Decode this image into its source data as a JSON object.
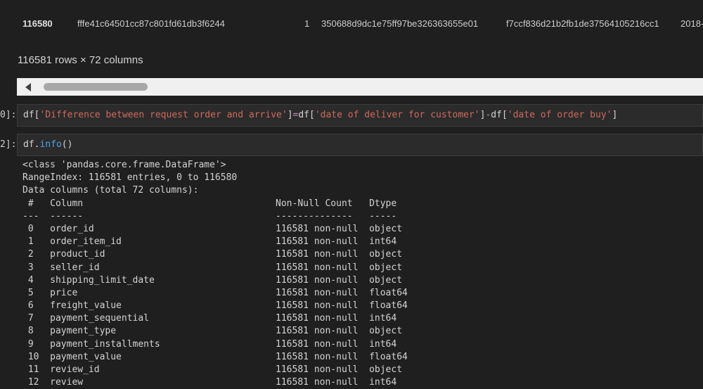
{
  "dataframe_row": {
    "index": "116580",
    "cells": [
      "fffe41c64501cc87c801fd61db3f6244",
      "1",
      "350688d9dc1e75ff97be326363655e01",
      "f7ccf836d21b2fb1de37564105216cc1",
      "2018-"
    ]
  },
  "shape_text": "116581 rows × 72 columns",
  "cells": [
    {
      "prompt": "0]:",
      "code_parts": [
        {
          "t": "df[",
          "c": "plain"
        },
        {
          "t": "'Difference between request order and arrive'",
          "c": "str"
        },
        {
          "t": "]",
          "c": "plain"
        },
        {
          "t": "=",
          "c": "op"
        },
        {
          "t": "df[",
          "c": "plain"
        },
        {
          "t": "'date of deliver for customer'",
          "c": "str"
        },
        {
          "t": "]",
          "c": "plain"
        },
        {
          "t": "-",
          "c": "op"
        },
        {
          "t": "df[",
          "c": "plain"
        },
        {
          "t": "'date of order buy'",
          "c": "str"
        },
        {
          "t": "]",
          "c": "plain"
        }
      ]
    },
    {
      "prompt": "2]:",
      "code_parts": [
        {
          "t": "df.",
          "c": "plain"
        },
        {
          "t": "info",
          "c": "fn"
        },
        {
          "t": "()",
          "c": "plain"
        }
      ]
    }
  ],
  "output_lines": [
    "<class 'pandas.core.frame.DataFrame'>",
    "RangeIndex: 116581 entries, 0 to 116580",
    "Data columns (total 72 columns):",
    " #   Column                                   Non-Null Count   Dtype  ",
    "---  ------                                   --------------   -----  ",
    " 0   order_id                                 116581 non-null  object ",
    " 1   order_item_id                            116581 non-null  int64  ",
    " 2   product_id                               116581 non-null  object ",
    " 3   seller_id                                116581 non-null  object ",
    " 4   shipping_limit_date                      116581 non-null  object ",
    " 5   price                                    116581 non-null  float64",
    " 6   freight_value                            116581 non-null  float64",
    " 7   payment_sequential                       116581 non-null  int64  ",
    " 8   payment_type                             116581 non-null  object ",
    " 9   payment_installments                     116581 non-null  int64  ",
    " 10  payment_value                            116581 non-null  float64",
    " 11  review_id                                116581 non-null  object ",
    " 12  review                                   116581 non-null  int64  "
  ]
}
